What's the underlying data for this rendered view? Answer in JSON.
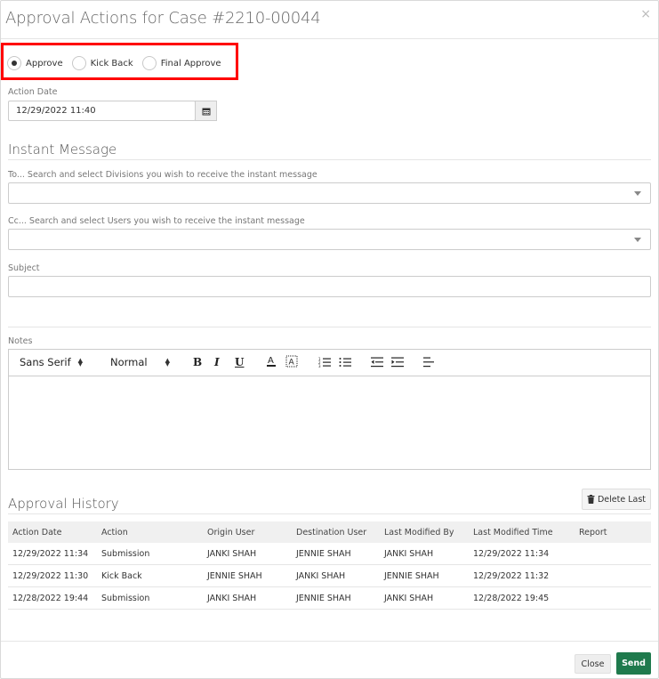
{
  "modal": {
    "title": "Approval Actions for Case #2210-00044",
    "close_glyph": "×"
  },
  "radios": [
    {
      "label": "Approve",
      "checked": true
    },
    {
      "label": "Kick Back",
      "checked": false
    },
    {
      "label": "Final Approve",
      "checked": false
    }
  ],
  "action_date": {
    "label": "Action Date",
    "value": "12/29/2022 11:40"
  },
  "instant_message": {
    "section_title": "Instant Message",
    "to_label": "To... Search and select Divisions you wish to receive the instant message",
    "cc_label": "Cc... Search and select Users you wish to receive the instant message",
    "subject_label": "Subject",
    "subject_value": ""
  },
  "notes": {
    "label": "Notes",
    "font_family": "Sans Serif",
    "font_size": "Normal",
    "toolbar_icons": [
      "bold-icon",
      "italic-icon",
      "underline-icon",
      "font-color-icon",
      "background-color-icon",
      "ordered-list-icon",
      "bullet-list-icon",
      "outdent-icon",
      "indent-icon",
      "align-icon"
    ]
  },
  "approval_history": {
    "section_title": "Approval History",
    "delete_last_label": "Delete Last",
    "columns": [
      "Action Date",
      "Action",
      "Origin User",
      "Destination User",
      "Last Modified By",
      "Last Modified Time",
      "Report"
    ],
    "rows": [
      [
        "12/29/2022 11:34",
        "Submission",
        "JANKI SHAH",
        "JENNIE SHAH",
        "JANKI SHAH",
        "12/29/2022 11:34",
        ""
      ],
      [
        "12/29/2022 11:30",
        "Kick Back",
        "JENNIE SHAH",
        "JANKI SHAH",
        "JENNIE SHAH",
        "12/29/2022 11:32",
        ""
      ],
      [
        "12/28/2022 19:44",
        "Submission",
        "JANKI SHAH",
        "JENNIE SHAH",
        "JANKI SHAH",
        "12/28/2022 19:45",
        ""
      ]
    ]
  },
  "footer": {
    "close_label": "Close",
    "send_label": "Send"
  },
  "colors": {
    "highlight": "#ff0000",
    "send": "#1f7a4d"
  }
}
